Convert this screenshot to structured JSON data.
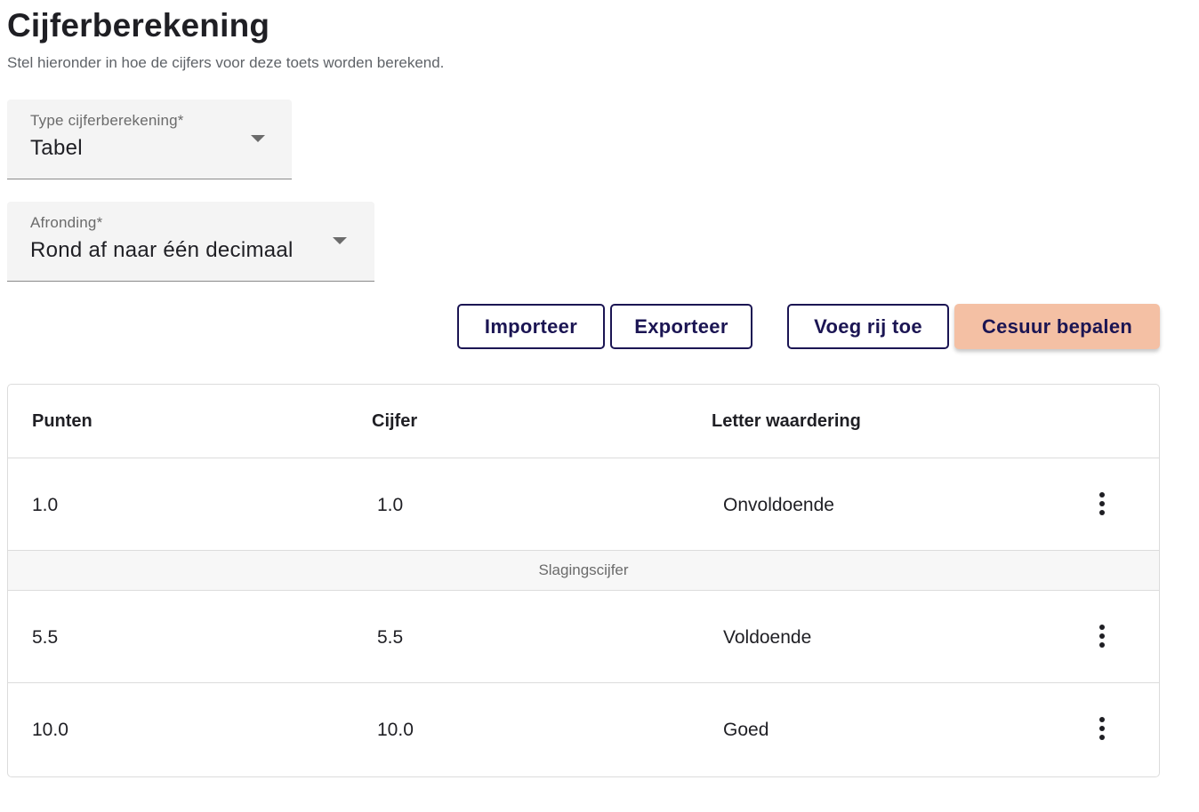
{
  "header": {
    "title": "Cijferberekening",
    "subtitle": "Stel hieronder in hoe de cijfers voor deze toets worden berekend."
  },
  "fields": {
    "calc_type": {
      "label": "Type cijferberekening*",
      "value": "Tabel"
    },
    "rounding": {
      "label": "Afronding*",
      "value": "Rond af naar één decimaal"
    }
  },
  "actions": {
    "import": "Importeer",
    "export": "Exporteer",
    "add_row": "Voeg rij toe",
    "cesuur": "Cesuur bepalen"
  },
  "table": {
    "columns": [
      "Punten",
      "Cijfer",
      "Letter waardering"
    ],
    "rows": [
      {
        "points": "1.0",
        "grade": "1.0",
        "letter": "Onvoldoende"
      },
      {
        "points": "5.5",
        "grade": "5.5",
        "letter": "Voldoende"
      },
      {
        "points": "10.0",
        "grade": "10.0",
        "letter": "Goed"
      }
    ],
    "pass_marker": "Slagingscijfer"
  },
  "colors": {
    "primary": "#1b1553",
    "accent": "#f4c0a4",
    "border": "#dcdcdc"
  },
  "icons": {
    "dropdown": "caret-down-icon",
    "row_menu": "more-vertical-icon"
  }
}
